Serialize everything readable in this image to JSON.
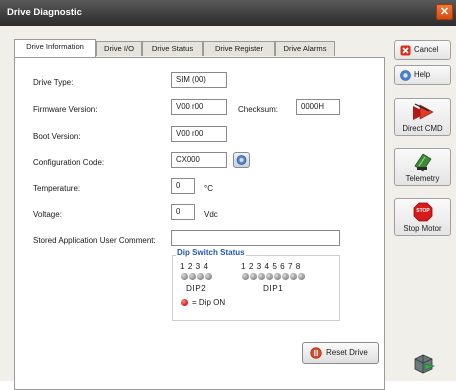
{
  "window": {
    "title": "Drive Diagnostic",
    "close_symbol": "✕"
  },
  "tabs": [
    {
      "label": "Drive Information",
      "active": true
    },
    {
      "label": "Drive I/O",
      "active": false
    },
    {
      "label": "Drive Status",
      "active": false
    },
    {
      "label": "Drive Register",
      "active": false
    },
    {
      "label": "Drive Alarms",
      "active": false
    }
  ],
  "info": {
    "drive_type": {
      "label": "Drive Type:",
      "value": "SIM (00)"
    },
    "firmware": {
      "label": "Firmware Version:",
      "value": "V00 r00"
    },
    "checksum": {
      "label": "Checksum:",
      "value": "0000H"
    },
    "boot": {
      "label": "Boot Version:",
      "value": "V00 r00"
    },
    "config": {
      "label": "Configuration Code:",
      "value": "CX000"
    },
    "temperature": {
      "label": "Temperature:",
      "value": "0",
      "unit": "°C"
    },
    "voltage": {
      "label": "Voltage:",
      "value": "0",
      "unit": "Vdc"
    },
    "comment": {
      "label": "Stored Application User Comment:",
      "value": ""
    }
  },
  "dip": {
    "title": "Dip Switch Status",
    "dip2_numbers": "1 2 3 4",
    "dip1_numbers": "1 2 3 4 5 6 7 8",
    "dip2_label": "DIP2",
    "dip1_label": "DIP1",
    "legend": "= Dip ON",
    "dip2_on": [
      false,
      false,
      false,
      false
    ],
    "dip1_on": [
      false,
      false,
      false,
      false,
      false,
      false,
      false,
      false
    ]
  },
  "buttons": {
    "reset": "Reset Drive",
    "cancel": "Cancel",
    "help": "Help",
    "direct_cmd": "Direct CMD",
    "telemetry": "Telemetry",
    "stop_motor": "Stop Motor",
    "stop_icon_text": "STOP"
  },
  "colors": {
    "accent_blue": "#2457b5",
    "cancel_red": "#d8301a",
    "stop_red": "#d81a1a",
    "titlebar": "#3c3c3c",
    "close_orange": "#e55f20"
  }
}
